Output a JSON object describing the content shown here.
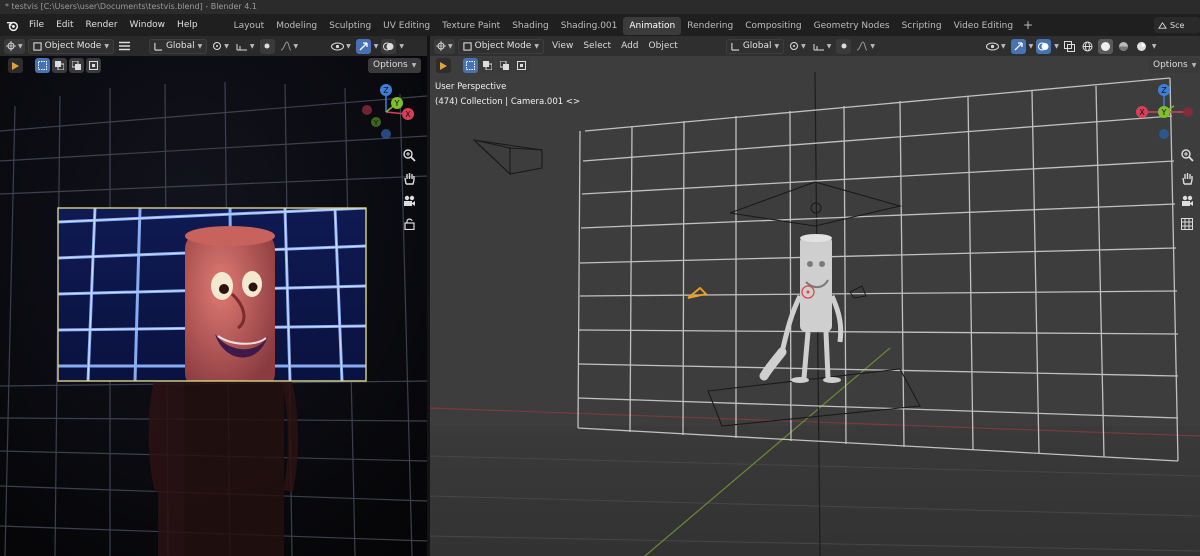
{
  "window": {
    "title": "* testvis [C:\\Users\\user\\Documents\\testvis.blend] - Blender 4.1"
  },
  "menu": [
    "File",
    "Edit",
    "Render",
    "Window",
    "Help"
  ],
  "workspace_tabs": [
    "Layout",
    "Modeling",
    "Sculpting",
    "UV Editing",
    "Texture Paint",
    "Shading",
    "Shading.001",
    "Animation",
    "Rendering",
    "Compositing",
    "Geometry Nodes",
    "Scripting",
    "Video Editing"
  ],
  "active_tab": "Animation",
  "scene_selector": "Sce",
  "left_viewport": {
    "mode": "Object Mode",
    "orientation": "Global",
    "options_label": "Options"
  },
  "right_viewport": {
    "mode": "Object Mode",
    "menu": [
      "View",
      "Select",
      "Add",
      "Object"
    ],
    "orientation": "Global",
    "options_label": "Options",
    "view_name": "User Perspective",
    "collection_info": "(474) Collection | Camera.001 <>"
  },
  "colors": {
    "accent": "#4772b3",
    "active_tab": "#3b3b3b",
    "camera_frame": "#d9d48a",
    "axis_x": "#d8405a",
    "axis_y": "#7fbf2c",
    "axis_z": "#3d7fd8"
  },
  "icons": [
    "blender-logo",
    "cursor-icon",
    "object-mode-icon",
    "menu-icon",
    "transform-orientation-icon",
    "snap-icon",
    "proportional-edit-icon",
    "visibility-icon",
    "gizmo-icon",
    "overlay-icon",
    "xray-icon",
    "shading-wireframe-icon",
    "shading-solid-icon",
    "shading-material-icon",
    "shading-rendered-icon",
    "zoom-icon",
    "hand-icon",
    "camera-icon",
    "lock-icon",
    "grid-icon"
  ]
}
